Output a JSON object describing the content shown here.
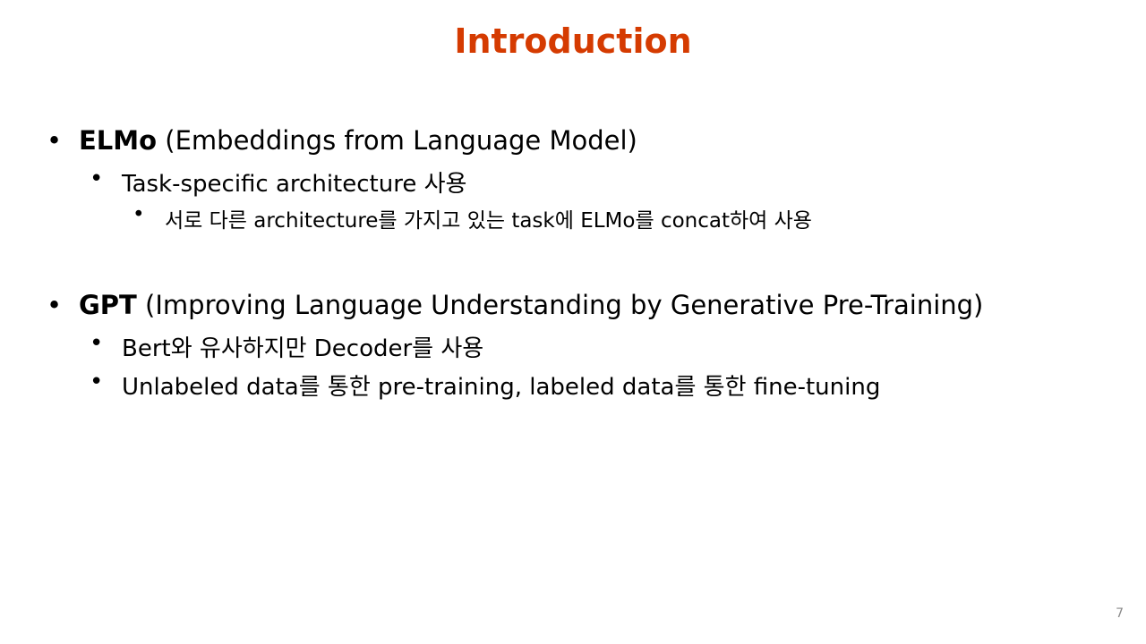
{
  "slide": {
    "title": "Introduction",
    "page_number": "7",
    "accent_color": "#D53B01",
    "bullet_glyph": "•",
    "items": [
      {
        "bold": "ELMo",
        "rest": " (Embeddings from Language Model)"
      },
      {
        "text": "Task-specific architecture 사용"
      },
      {
        "text": "서로 다른 architecture를 가지고 있는 task에 ELMo를 concat하여 사용"
      },
      {
        "bold": "GPT",
        "rest": " (Improving Language Understanding by Generative Pre-Training)"
      },
      {
        "text": "Bert와 유사하지만 Decoder를 사용"
      },
      {
        "text": "Unlabeled data를 통한 pre-training, labeled data를 통한 fine-tuning"
      }
    ]
  }
}
